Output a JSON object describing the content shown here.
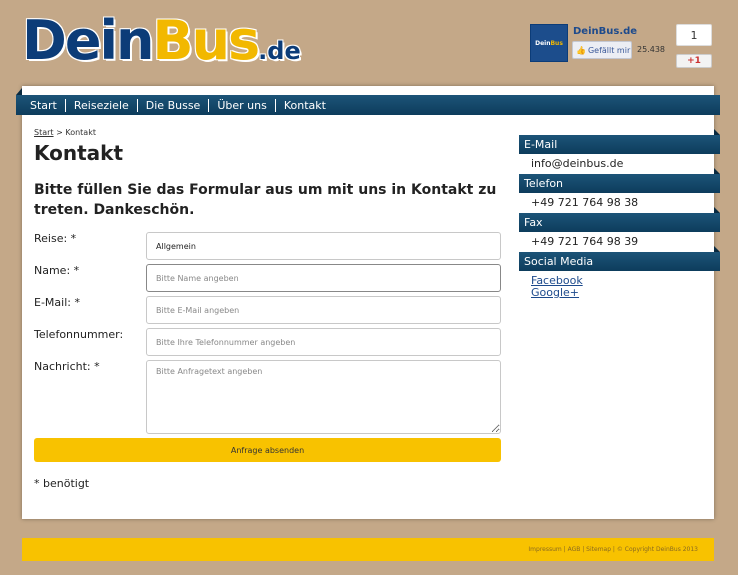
{
  "header": {
    "logo_dein": "Dein",
    "logo_bus": "Bus",
    "logo_tld": ".de",
    "fb_page_name": "DeinBus.de",
    "fb_thumb_dein": "Dein",
    "fb_thumb_bus": "Bus",
    "fb_like_label": "Gefällt mir",
    "fb_like_count": "25.438",
    "gplus_count": "1",
    "gplus_label": "+1"
  },
  "nav": {
    "items": [
      {
        "label": "Start"
      },
      {
        "label": "Reiseziele"
      },
      {
        "label": "Die Busse"
      },
      {
        "label": "Über uns"
      },
      {
        "label": "Kontakt"
      }
    ]
  },
  "breadcrumb": {
    "home": "Start",
    "separator": " > ",
    "current": "Kontakt"
  },
  "main": {
    "title": "Kontakt",
    "intro": "Bitte füllen Sie das Formular aus um mit uns in Kontakt zu treten. Dankeschön."
  },
  "form": {
    "reise_label": "Reise: *",
    "reise_value": "Allgemein",
    "name_label": "Name: *",
    "name_placeholder": "Bitte Name angeben",
    "email_label": "E-Mail: *",
    "email_placeholder": "Bitte E-Mail angeben",
    "phone_label": "Telefonnummer:",
    "phone_placeholder": "Bitte Ihre Telefonnummer angeben",
    "message_label": "Nachricht: *",
    "message_placeholder": "Bitte Anfragetext angeben",
    "submit_label": "Anfrage absenden",
    "required_note": "* benötigt"
  },
  "sidebar": {
    "email_heading": "E-Mail",
    "email_value": "info@deinbus.de",
    "phone_heading": "Telefon",
    "phone_value": "+49 721 764 98 38",
    "fax_heading": "Fax",
    "fax_value": "+49 721 764 98 39",
    "social_heading": "Social Media",
    "facebook_label": "Facebook",
    "googleplus_label": "Google+"
  },
  "footer": {
    "text": "Impressum | AGB | Sitemap | © Copyright DeinBus 2013"
  },
  "colors": {
    "background": "#c4a888",
    "nav_blue": "#0d3c5c",
    "accent_yellow": "#f8c200",
    "logo_blue": "#0c3c78"
  }
}
